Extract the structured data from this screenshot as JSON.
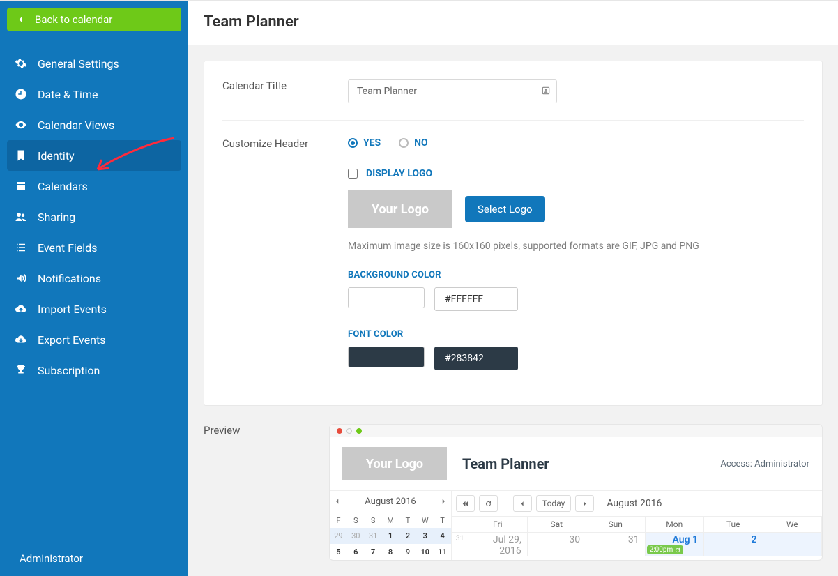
{
  "back_label": "Back to calendar",
  "page_title": "Team Planner",
  "sidebar": {
    "items": [
      {
        "label": "General Settings"
      },
      {
        "label": "Date & Time"
      },
      {
        "label": "Calendar Views"
      },
      {
        "label": "Identity"
      },
      {
        "label": "Calendars"
      },
      {
        "label": "Sharing"
      },
      {
        "label": "Event Fields"
      },
      {
        "label": "Notifications"
      },
      {
        "label": "Import Events"
      },
      {
        "label": "Export Events"
      },
      {
        "label": "Subscription"
      }
    ],
    "footer": "Administrator"
  },
  "form": {
    "calendar_title_label": "Calendar Title",
    "calendar_title_value": "Team Planner",
    "customize_header_label": "Customize Header",
    "yes_label": "YES",
    "no_label": "NO",
    "display_logo_label": "DISPLAY LOGO",
    "your_logo": "Your Logo",
    "select_logo_btn": "Select Logo",
    "logo_hint": "Maximum image size is 160x160 pixels, supported formats are GIF, JPG and PNG",
    "bg_color_label": "BACKGROUND COLOR",
    "bg_color_value": "#FFFFFF",
    "font_color_label": "FONT COLOR",
    "font_color_value": "#283842"
  },
  "preview": {
    "section_label": "Preview",
    "title": "Team Planner",
    "access": "Access: Administrator",
    "month_label": "August 2016",
    "mini_days": [
      "F",
      "S",
      "S",
      "M",
      "T",
      "W",
      "T"
    ],
    "mini_r1": [
      "29",
      "30",
      "31",
      "1",
      "2",
      "3",
      "4"
    ],
    "mini_r2": [
      "5",
      "6",
      "7",
      "8",
      "9",
      "10",
      "11"
    ],
    "today_btn": "Today",
    "week_days": [
      "Fri",
      "Sat",
      "Sun",
      "Mon",
      "Tue",
      "We"
    ],
    "date1": "Jul 29, 2016",
    "d2": "30",
    "d3": "31",
    "d4": "Aug 1",
    "d5": "2",
    "event_time": "2:00pm"
  },
  "colors": {
    "accent": "#1177bb",
    "bg": "#FFFFFF",
    "font": "#283842"
  }
}
